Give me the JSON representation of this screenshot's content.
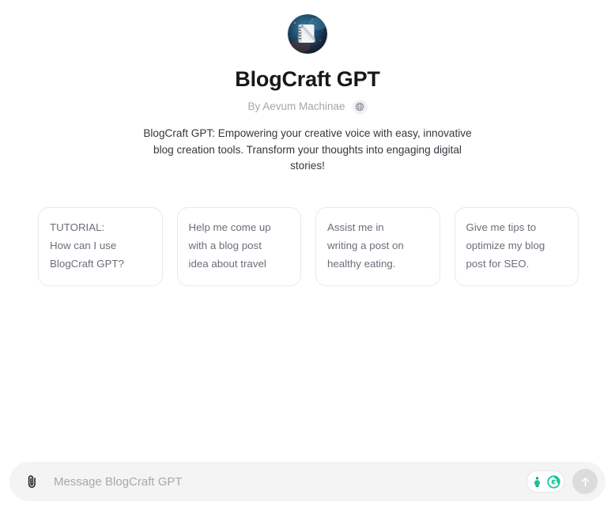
{
  "gpt": {
    "title": "BlogCraft GPT",
    "byline": "By Aevum Machinae",
    "description": "BlogCraft GPT: Empowering your creative voice with easy, innovative blog creation tools. Transform your thoughts into engaging digital stories!",
    "avatar_icon": "notebook-pencil-icon",
    "globe_icon": "globe-icon"
  },
  "starters": [
    {
      "text": "TUTORIAL:\nHow can I use\nBlogCraft GPT?"
    },
    {
      "text": "Help me come up\nwith a blog post\nidea about travel"
    },
    {
      "text": "Assist me in\nwriting a post on\nhealthy eating."
    },
    {
      "text": "Give me tips to\noptimize my blog\npost for SEO."
    }
  ],
  "composer": {
    "placeholder": "Message BlogCraft GPT",
    "value": "",
    "attach_icon": "paperclip-icon",
    "send_icon": "arrow-up-icon",
    "grammarly": {
      "lightbulb_icon": "lightbulb-icon",
      "logo_icon": "grammarly-g-icon"
    }
  },
  "colors": {
    "page_background": "#ffffff",
    "title": "#16181c",
    "byline": "#a6a6ae",
    "description": "#33373d",
    "card_border": "#e9e9ec",
    "card_text": "#6d6d7a",
    "composer_background": "#f4f4f4",
    "placeholder": "#a8a8ad",
    "send_button": "#dcdcdc",
    "grammarly_teal": "#15c39a",
    "grammarly_dark_teal": "#0b8a72"
  }
}
